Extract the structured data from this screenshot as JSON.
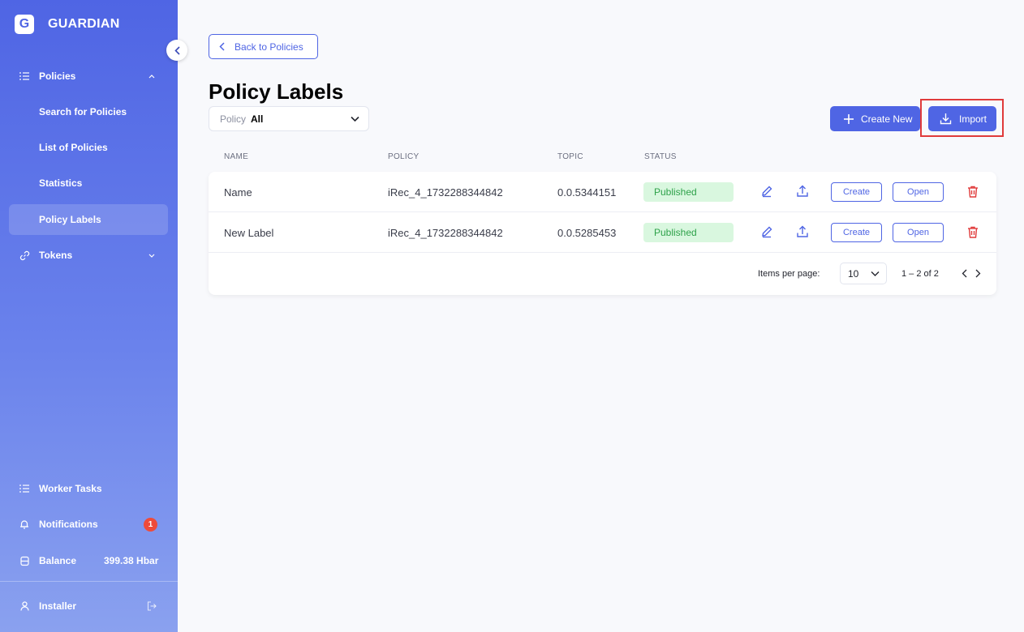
{
  "app": {
    "brand": "GUARDIAN",
    "logo_letter": "G"
  },
  "sidebar": {
    "policies": {
      "label": "Policies",
      "expanded": true
    },
    "sub_items": [
      "Search for Policies",
      "List of Policies",
      "Statistics",
      "Policy Labels"
    ],
    "active_item": "Policy Labels",
    "tokens": {
      "label": "Tokens"
    },
    "worker_tasks": {
      "label": "Worker Tasks"
    },
    "notifications": {
      "label": "Notifications",
      "count": "1"
    },
    "balance": {
      "label": "Balance",
      "value": "399.38 Hbar"
    },
    "user": {
      "label": "Installer"
    }
  },
  "header": {
    "back_label": "Back to Policies",
    "title": "Policy Labels",
    "filter": {
      "label": "Policy",
      "value": "All"
    },
    "create_new_label": "Create New",
    "import_label": "Import"
  },
  "table": {
    "columns": [
      "NAME",
      "POLICY",
      "TOPIC",
      "STATUS"
    ],
    "rows": [
      {
        "name": "Name",
        "policy": "iRec_4_1732288344842",
        "topic": "0.0.5344151",
        "status": "Published",
        "create_label": "Create",
        "open_label": "Open"
      },
      {
        "name": "New Label",
        "policy": "iRec_4_1732288344842",
        "topic": "0.0.5285453",
        "status": "Published",
        "create_label": "Create",
        "open_label": "Open"
      }
    ]
  },
  "paginator": {
    "items_per_page_label": "Items per page:",
    "page_size": "10",
    "range": "1 – 2 of 2"
  },
  "colors": {
    "accent": "#4f65e4",
    "success_bg": "#d9f7df",
    "success_text": "#2ea24a",
    "danger": "#e03b3b"
  }
}
